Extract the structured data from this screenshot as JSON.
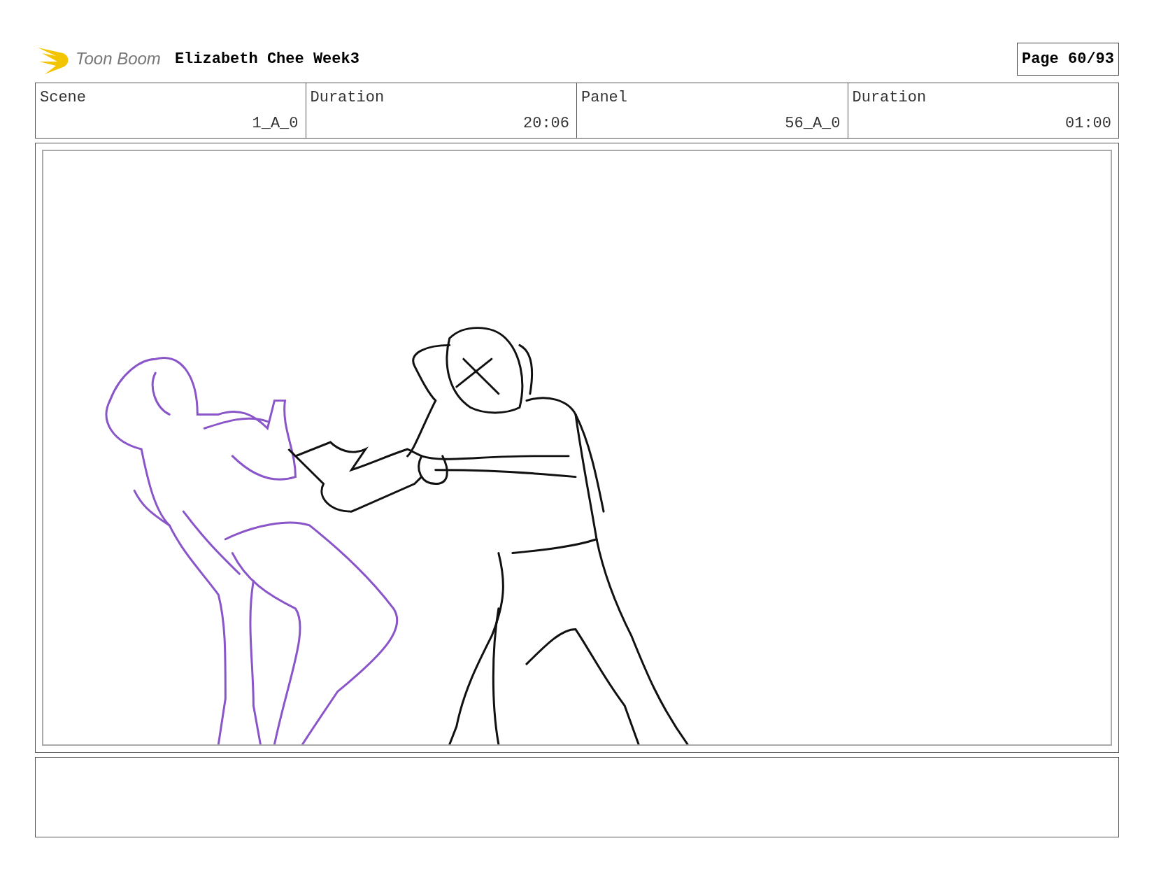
{
  "header": {
    "logo_text": "Toon Boom",
    "title": "Elizabeth Chee Week3",
    "page": "Page 60/93"
  },
  "info": {
    "labels": [
      "Scene",
      "Duration",
      "Panel",
      "Duration"
    ],
    "values": [
      "1_A_0",
      "20:06",
      "56_A_0",
      "01:00"
    ]
  }
}
